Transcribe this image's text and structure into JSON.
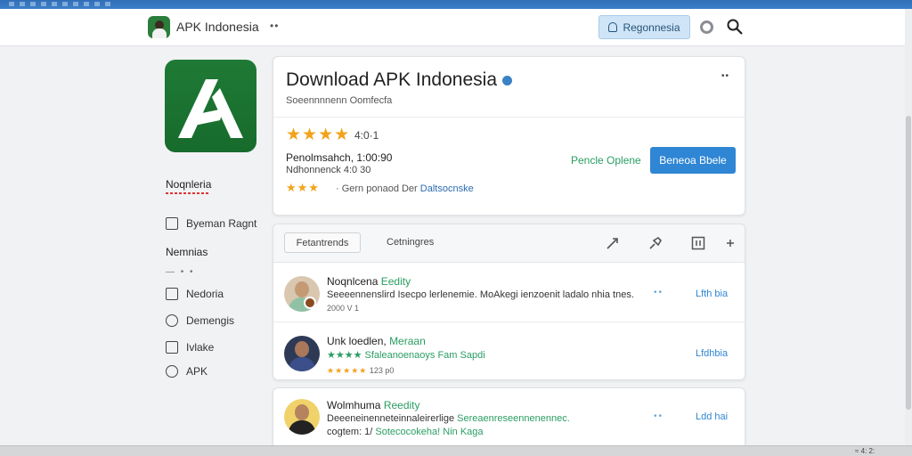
{
  "appbar": {
    "app_name": "APK Indonesia",
    "more": "••",
    "register_label": "Regonnesia"
  },
  "sidebar": {
    "title": "Noqnleria",
    "items": [
      {
        "label": "Byeman Ragnt",
        "icon": "edit-icon"
      },
      {
        "label": "Nedoria",
        "icon": "calendar-icon"
      },
      {
        "label": "Demengis",
        "icon": "chat-icon"
      },
      {
        "label": "Ivlake",
        "icon": "mail-icon"
      },
      {
        "label": "APK",
        "icon": "comment-icon"
      }
    ],
    "heading": "Nemnias",
    "dots": "— • •"
  },
  "hero": {
    "title": "Download APK Indonesia",
    "subtitle": "Soeennnnenn Oomfecfa",
    "menu": "••",
    "stars": "★★★★",
    "rating": "4:0·1",
    "info_line1": "Penolmsahch, 1:00:90",
    "info_line2": "Ndhonnenck 4:0 30",
    "stars_small": "★★★",
    "review_prefix": "· Gern ponaod Der",
    "review_link": "Daltsocnske",
    "secondary_button": "Pencle Oplene",
    "primary_button": "Beneoa Bbele"
  },
  "reviews": {
    "tab_active": "Fetantrends",
    "tab_other": "Cetningres",
    "rows": [
      {
        "name": "Noqnlcena",
        "tag": "Eedity",
        "text": "Seeeennenslird Isecpo lerlenemie. MoAkegi ienzoenit ladalo nhia tnes.",
        "text_link": "",
        "meta": "2000 V 1",
        "stars": "",
        "dots": "••",
        "link": "Lfth bia"
      },
      {
        "name": "Unk loedlen,",
        "tag": "Meraan",
        "text": "",
        "text_link": "★★★★ Sfaleanoenaoys Fam Sapdi",
        "meta": "123 p0",
        "stars": "★★★★★",
        "dots": "",
        "link": "Lfdhbia"
      }
    ]
  },
  "review3": {
    "name": "Wolmhuma",
    "tag": "Reedity",
    "text": "Deeeneinenneteinnaleirerlige",
    "text_link": "Sereaenreseennenennec.",
    "meta_prefix": "cogtem: 1/",
    "meta_link": "Sotecocokeha! Nin Kaga",
    "dots": "••",
    "link": "Ldd hai"
  },
  "taskbar": {
    "tray": "≈ 4: 2:"
  },
  "colors": {
    "accent": "#2f86d4",
    "green": "#2a9d63",
    "star": "#f2a31b",
    "logo": "#1f7a35"
  }
}
